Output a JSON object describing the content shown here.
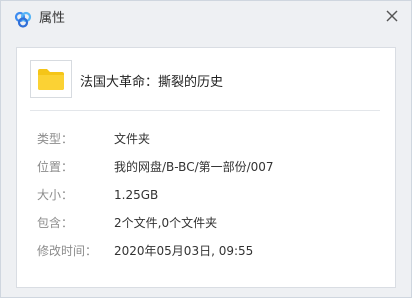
{
  "window": {
    "title": "属性",
    "close_icon": "close-icon",
    "app_icon": "baidu-netdisk-icon"
  },
  "file": {
    "icon": "folder-icon",
    "name": "法国大革命：撕裂的历史"
  },
  "properties": [
    {
      "label": "类型：",
      "value": "文件夹"
    },
    {
      "label": "位置：",
      "value": "我的网盘/B-BC/第一部份/007"
    },
    {
      "label": "大小：",
      "value": "1.25GB"
    },
    {
      "label": "包含：",
      "value": "2个文件,0个文件夹"
    },
    {
      "label": "修改时间：",
      "value": "2020年05月03日, 09:55"
    }
  ],
  "colors": {
    "folder": "#f5c518",
    "title_bar": "#eef0f3",
    "label_text": "#8c8c8c",
    "value_text": "#333333"
  }
}
